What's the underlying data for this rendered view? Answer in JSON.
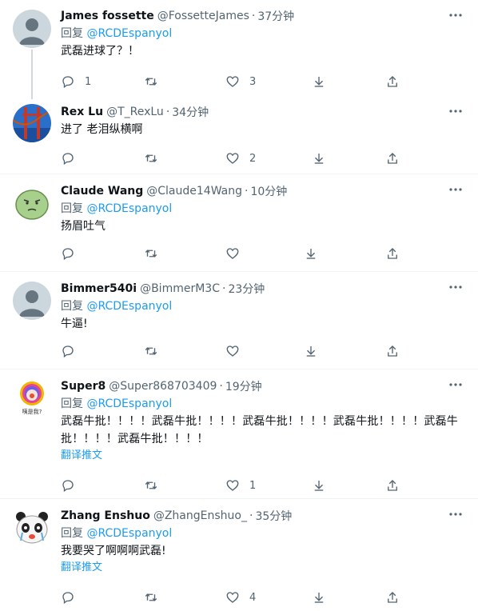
{
  "reply_prefix": "回复",
  "translate_label": "翻译推文",
  "tweets": [
    {
      "name": "James fossette",
      "handle": "@FossetteJames",
      "dot": "·",
      "time": "37分钟",
      "reply_to": "@RCDEspanyol",
      "text": "武磊进球了？！",
      "replies": "1",
      "retweets": "",
      "likes": "3",
      "avatar": "default-avatar"
    },
    {
      "name": "Rex Lu",
      "handle": "@T_RexLu",
      "dot": "·",
      "time": "34分钟",
      "reply_to": "",
      "text": "进了 老泪纵横啊",
      "replies": "",
      "retweets": "",
      "likes": "2",
      "avatar": "golden-gate-bridge"
    },
    {
      "name": "Claude Wang",
      "handle": "@Claude14Wang",
      "dot": "·",
      "time": "10分钟",
      "reply_to": "@RCDEspanyol",
      "text": "扬眉吐气",
      "replies": "",
      "retweets": "",
      "likes": "",
      "avatar": "green-cartoon-face"
    },
    {
      "name": "Bimmer540i",
      "handle": "@BimmerM3C",
      "dot": "·",
      "time": "23分钟",
      "reply_to": "@RCDEspanyol",
      "text": "牛逼!",
      "replies": "",
      "retweets": "",
      "likes": "",
      "avatar": "default-avatar"
    },
    {
      "name": "Super8",
      "handle": "@Super868703409",
      "dot": "·",
      "time": "19分钟",
      "reply_to": "@RCDEspanyol",
      "text": "武磊牛批！！！！武磊牛批！！！！武磊牛批！！！！武磊牛批！！！！武磊牛批！！！！武磊牛批！！！！",
      "replies": "",
      "retweets": "",
      "likes": "1",
      "avatar": "rainbow-clown-meme"
    },
    {
      "name": "Zhang Enshuo",
      "handle": "@ZhangEnshuo_",
      "dot": "·",
      "time": "35分钟",
      "reply_to": "@RCDEspanyol",
      "text": "我要哭了啊啊啊武磊!",
      "replies": "",
      "retweets": "",
      "likes": "4",
      "avatar": "panda-meme"
    }
  ],
  "avatar_captions": {
    "super8": "咦是我?"
  },
  "colors": {
    "accent": "#1d9bf0",
    "secondary_text": "#536471",
    "divider": "#eff3f4"
  }
}
